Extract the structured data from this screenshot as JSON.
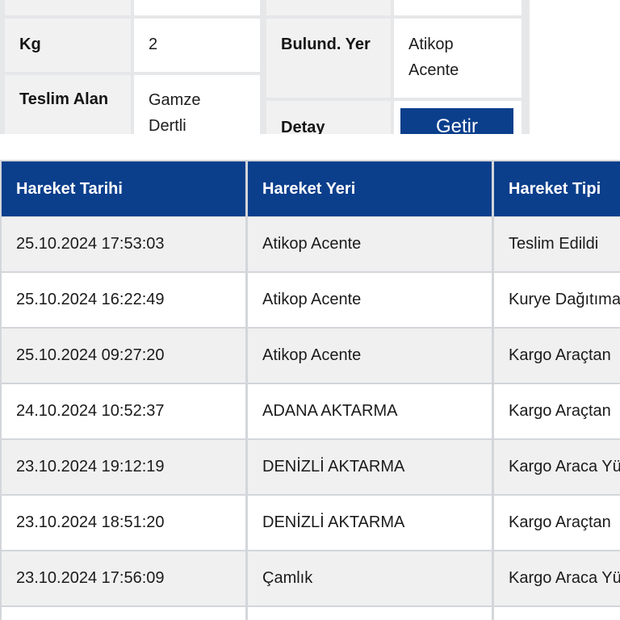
{
  "details": {
    "kg_label": "Kg",
    "kg_value": "2",
    "teslim_alan_label": "Teslim Alan",
    "teslim_alan_value": "Gamze Dertli",
    "bulund_yer_label": "Bulund. Yer",
    "bulund_yer_value": "Atikop Acente",
    "detay_label": "Detay",
    "getir_button": "Getir"
  },
  "movements": {
    "headers": [
      "Hareket Tarihi",
      "Hareket Yeri",
      "Hareket Tipi"
    ],
    "rows": [
      [
        "25.10.2024 17:53:03",
        "Atikop Acente",
        "Teslim Edildi"
      ],
      [
        "25.10.2024 16:22:49",
        "Atikop Acente",
        "Kurye Dağıtıma"
      ],
      [
        "25.10.2024 09:27:20",
        "Atikop Acente",
        "Kargo Araçtan"
      ],
      [
        "24.10.2024 10:52:37",
        "ADANA AKTARMA",
        "Kargo Araçtan"
      ],
      [
        "23.10.2024 19:12:19",
        "DENİZLİ AKTARMA",
        "Kargo Araca Yü"
      ],
      [
        "23.10.2024 18:51:20",
        "DENİZLİ AKTARMA",
        "Kargo Araçtan"
      ],
      [
        "23.10.2024 17:56:09",
        "Çamlık",
        "Kargo Araca Yü"
      ]
    ]
  },
  "colors": {
    "header_bg": "#0b3f8c",
    "button_bg": "#0b3f8c"
  }
}
